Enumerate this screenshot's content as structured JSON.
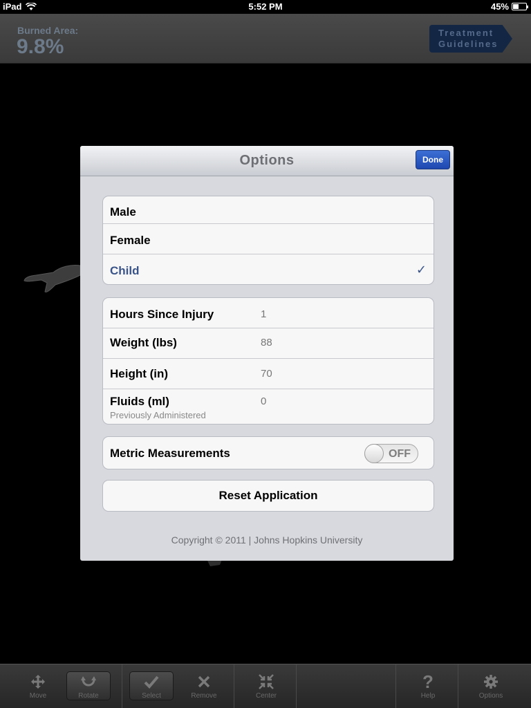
{
  "status_bar": {
    "device": "iPad",
    "time": "5:52 PM",
    "battery": "45%",
    "battery_level": 0.45
  },
  "header": {
    "burned_label": "Burned Area:",
    "burned_value": "9.8%",
    "guidelines_line1": "Treatment",
    "guidelines_line2": "Guidelines"
  },
  "modal": {
    "title": "Options",
    "done_label": "Done",
    "gender_options": [
      {
        "label": "Male",
        "selected": false
      },
      {
        "label": "Female",
        "selected": false
      },
      {
        "label": "Child",
        "selected": true,
        "check": "✓"
      }
    ],
    "fields": [
      {
        "label": "Hours Since Injury",
        "value": "1"
      },
      {
        "label": "Weight (lbs)",
        "value": "88"
      },
      {
        "label": "Height (in)",
        "value": "70"
      },
      {
        "label": "Fluids (ml)",
        "value": "0",
        "sublabel": "Previously Administered"
      }
    ],
    "metric": {
      "label": "Metric Measurements",
      "toggle_text": "OFF",
      "on": false
    },
    "reset_label": "Reset Application",
    "copyright": "Copyright © 2011 | Johns Hopkins University"
  },
  "toolbar": {
    "items": [
      {
        "label": "Move",
        "icon": "move-icon"
      },
      {
        "label": "Rotate",
        "icon": "rotate-icon"
      },
      {
        "label": "Select",
        "icon": "checkmark-icon"
      },
      {
        "label": "Remove",
        "icon": "x-icon"
      },
      {
        "label": "Center",
        "icon": "center-icon"
      },
      {
        "label": "Help",
        "icon": "question-icon"
      },
      {
        "label": "Options",
        "icon": "gear-icon"
      }
    ]
  },
  "colors": {
    "accent_blue": "#2a56c6",
    "selected_text": "#3a5488",
    "modal_bg": "#d7d9de"
  }
}
